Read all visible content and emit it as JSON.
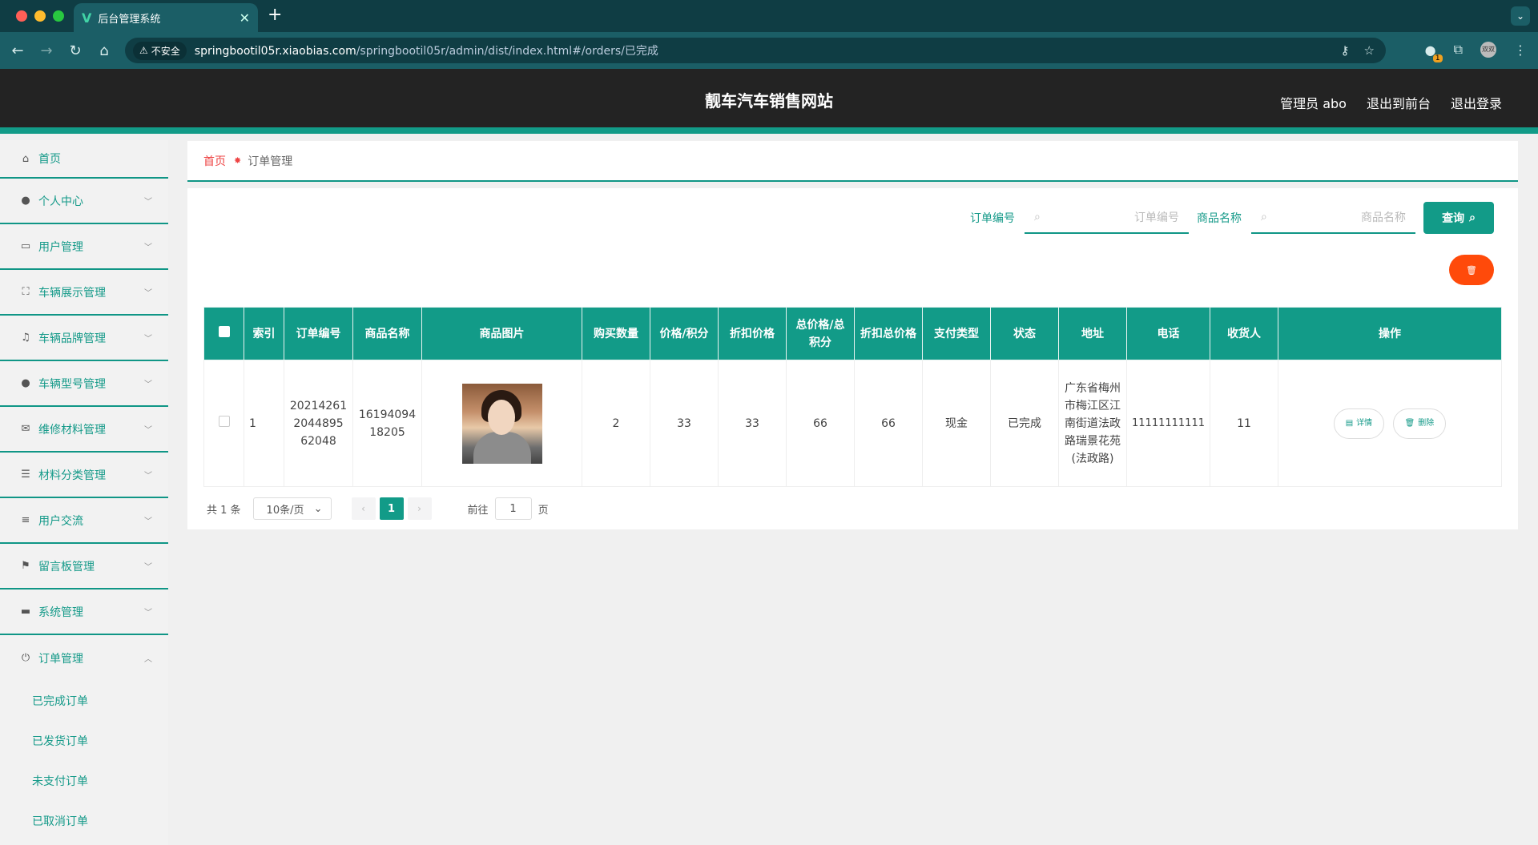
{
  "browser": {
    "tab_title": "后台管理系统",
    "insecure_label": "不安全",
    "url_host": "springbootil05r.xiaobias.com",
    "url_path": "/springbootil05r/admin/dist/index.html#/orders/已完成",
    "ext_badge": "1",
    "profile_label": "双双"
  },
  "header": {
    "site_title": "靓车汽车销售网站",
    "user_label": "管理员 abo",
    "front_link": "退出到前台",
    "logout_link": "退出登录"
  },
  "sidebar": {
    "items": [
      {
        "label": "首页",
        "icon": "home-icon"
      },
      {
        "label": "个人中心",
        "icon": "user-icon"
      },
      {
        "label": "用户管理",
        "icon": "chat-icon"
      },
      {
        "label": "车辆展示管理",
        "icon": "fullscreen-icon"
      },
      {
        "label": "车辆品牌管理",
        "icon": "bell-off-icon"
      },
      {
        "label": "车辆型号管理",
        "icon": "bulb-icon"
      },
      {
        "label": "维修材料管理",
        "icon": "mail-icon"
      },
      {
        "label": "材料分类管理",
        "icon": "list-icon"
      },
      {
        "label": "用户交流",
        "icon": "sliders-icon"
      },
      {
        "label": "留言板管理",
        "icon": "flag-icon"
      },
      {
        "label": "系统管理",
        "icon": "brush-icon"
      },
      {
        "label": "订单管理",
        "icon": "power-icon"
      }
    ],
    "sub_items": [
      "已完成订单",
      "已发货订单",
      "未支付订单",
      "已取消订单"
    ]
  },
  "breadcrumb": {
    "home": "首页",
    "current": "订单管理"
  },
  "search": {
    "order_label": "订单编号",
    "order_placeholder": "订单编号",
    "product_label": "商品名称",
    "product_placeholder": "商品名称",
    "query_label": "查询"
  },
  "table": {
    "headers": [
      "索引",
      "订单编号",
      "商品名称",
      "商品图片",
      "购买数量",
      "价格/积分",
      "折扣价格",
      "总价格/总积分",
      "折扣总价格",
      "支付类型",
      "状态",
      "地址",
      "电话",
      "收货人",
      "操作"
    ],
    "rows": [
      {
        "index": "1",
        "order_no": "202142612044895 62048",
        "product": "1619409418205",
        "qty": "2",
        "price": "33",
        "discount": "33",
        "total": "66",
        "discount_total": "66",
        "pay_type": "现金",
        "status": "已完成",
        "address": "广东省梅州市梅江区江南街道法政路瑞景花苑(法政路)",
        "phone": "11111111111",
        "receiver": "11",
        "detail_label": "详情",
        "delete_label": "删除"
      }
    ]
  },
  "pager": {
    "total": "共 1 条",
    "size": "10条/页",
    "current": "1",
    "goto_prefix": "前往",
    "goto_value": "1",
    "goto_suffix": "页"
  },
  "colors": {
    "accent": "#129b88",
    "danger": "#ff4a0a",
    "header_bg": "#232323"
  }
}
